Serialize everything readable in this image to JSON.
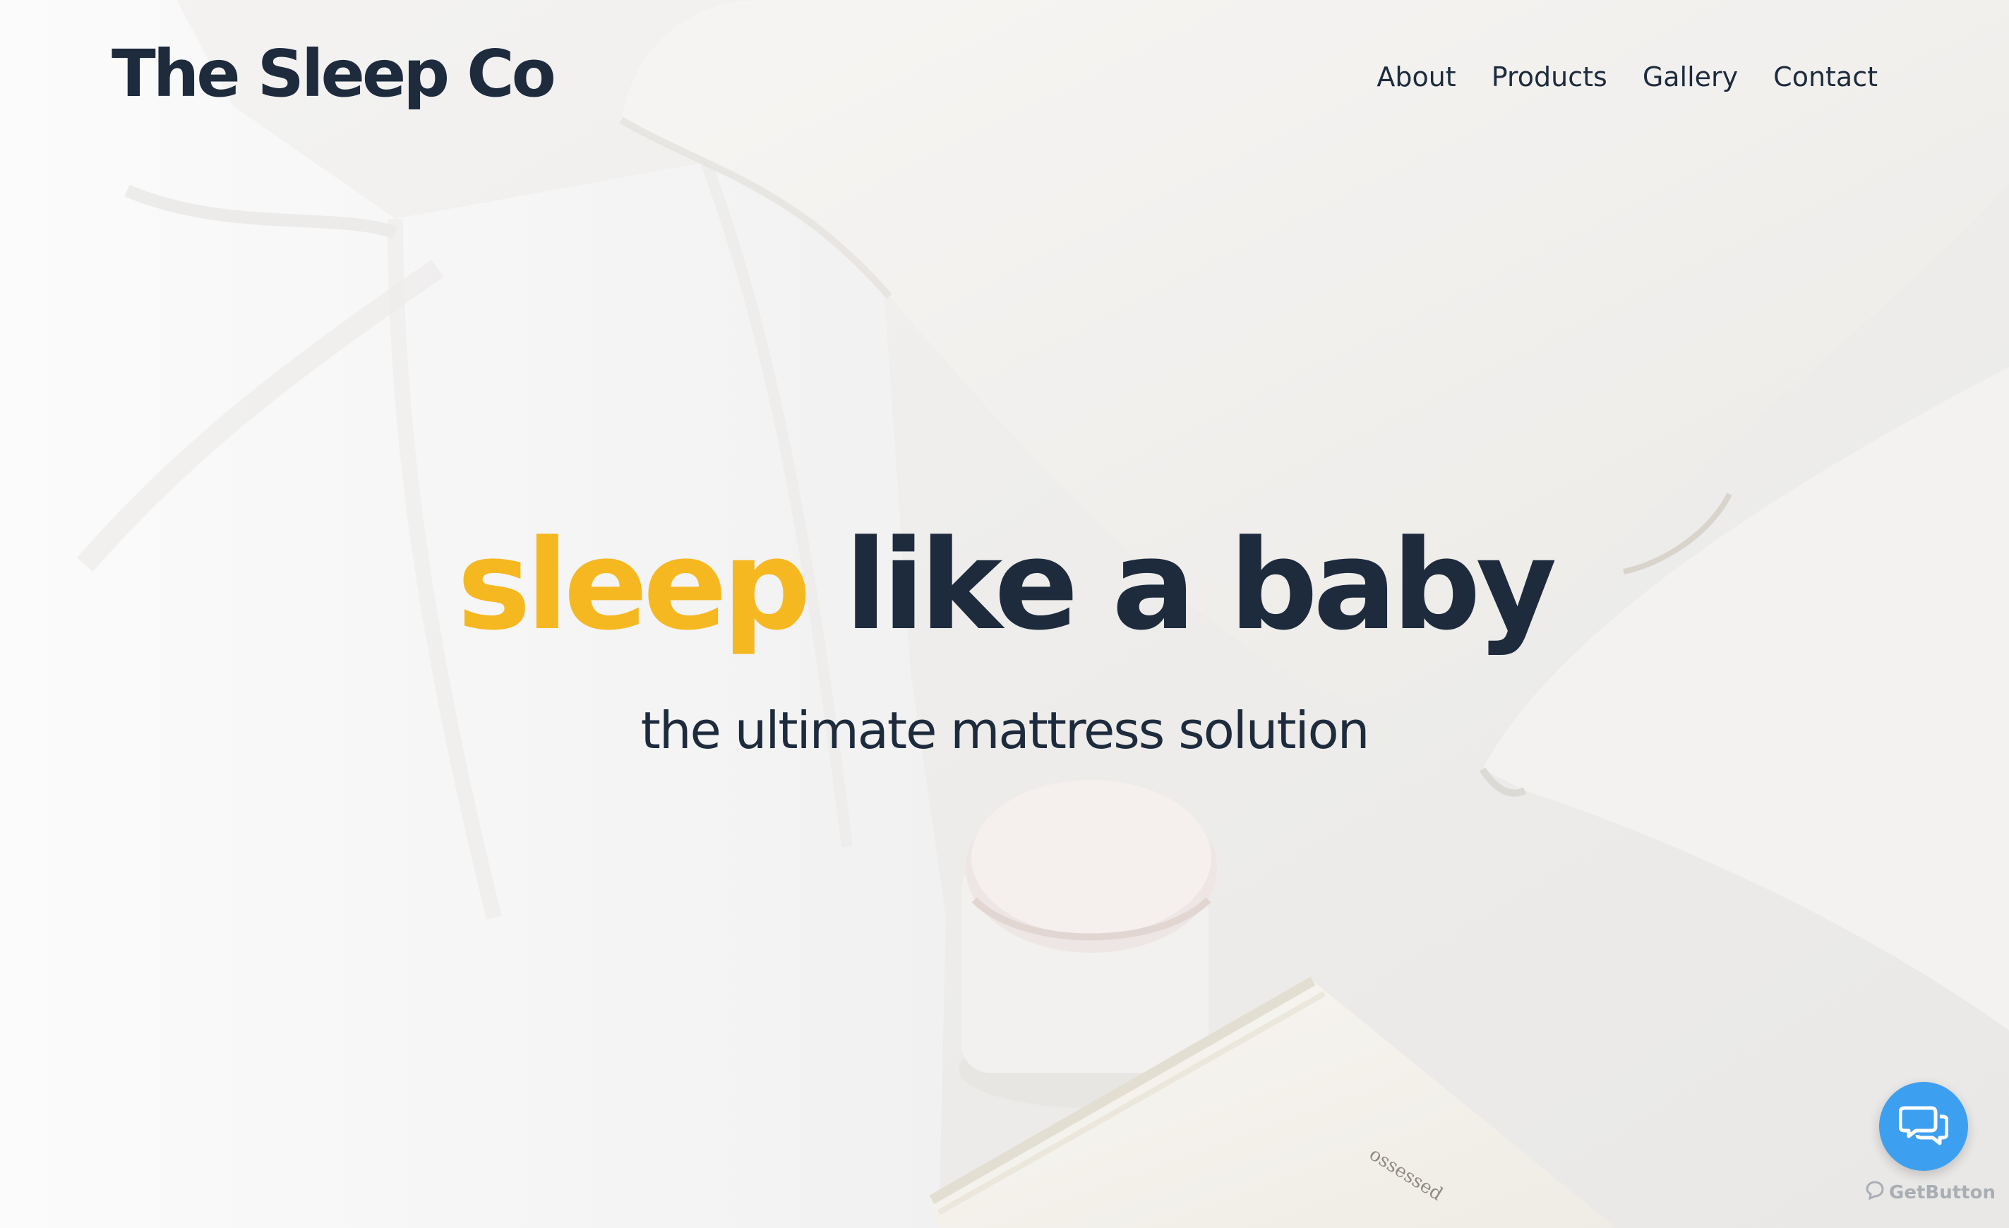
{
  "header": {
    "brand": "The Sleep Co",
    "nav": [
      "About",
      "Products",
      "Gallery",
      "Contact"
    ]
  },
  "hero": {
    "headline_accent": "sleep",
    "headline_rest": "like a baby",
    "tagline": "the ultimate mattress solution",
    "background_image": "white bedding with pillows, candle and book"
  },
  "widget": {
    "chat_icon": "chat-bubbles-icon",
    "powered_by": "GetButton"
  },
  "colors": {
    "accent": "#f6b821",
    "text_dark": "#1d2b3d",
    "chat_blue": "#3d9ff0"
  }
}
